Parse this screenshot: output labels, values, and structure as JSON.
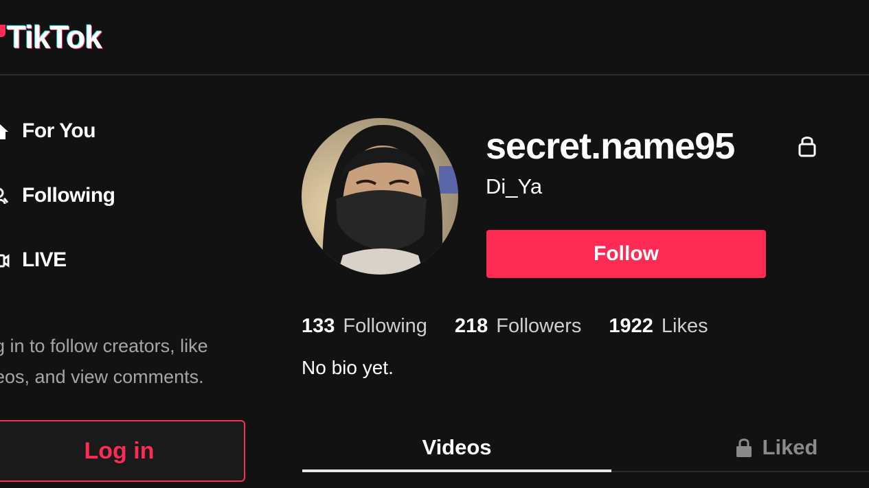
{
  "header": {
    "logo_text": "TikTok"
  },
  "sidebar": {
    "items": [
      {
        "label": "For You",
        "icon": "home-icon"
      },
      {
        "label": "Following",
        "icon": "users-icon"
      },
      {
        "label": "LIVE",
        "icon": "live-icon"
      }
    ],
    "login_hint_line1": "g in to follow creators, like",
    "login_hint_line2": "eos, and view comments.",
    "login_button": "Log in"
  },
  "profile": {
    "username": "secret.name95",
    "nickname": "Di_Ya",
    "follow_label": "Follow",
    "stats": [
      {
        "count": "133",
        "label": "Following"
      },
      {
        "count": "218",
        "label": "Followers"
      },
      {
        "count": "1922",
        "label": "Likes"
      }
    ],
    "bio": "No bio yet."
  },
  "tabs": [
    {
      "label": "Videos",
      "active": true
    },
    {
      "label": "Liked",
      "locked": true
    }
  ],
  "colors": {
    "accent": "#fe2c55",
    "background": "#121212",
    "text_secondary": "#a6a6a6"
  }
}
